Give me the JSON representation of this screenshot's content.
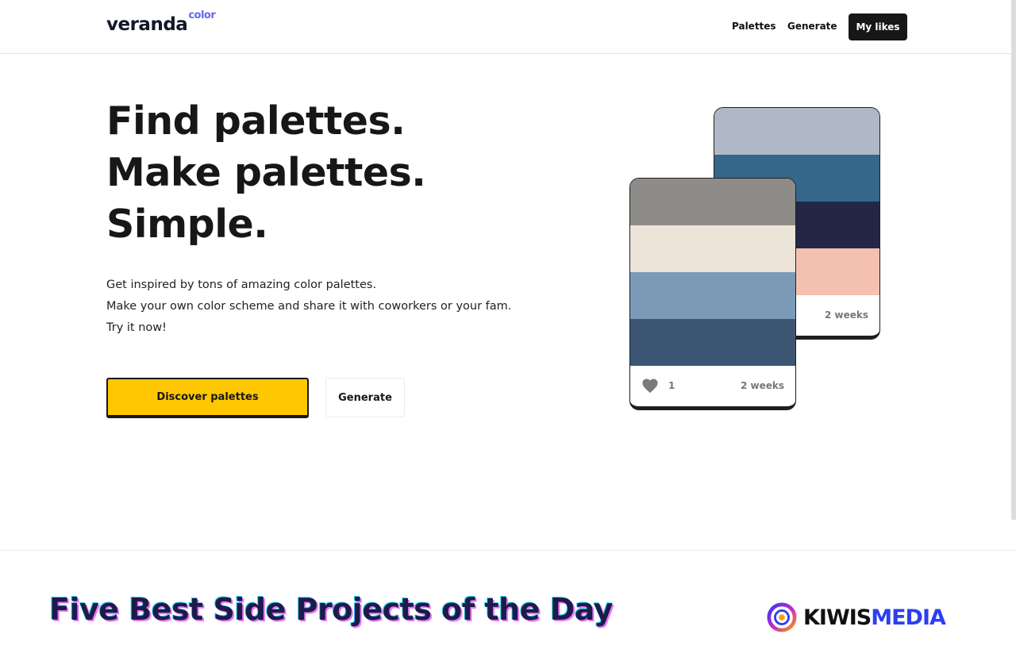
{
  "nav": {
    "logo_main": "veranda",
    "logo_sup": "color",
    "links": [
      "Palettes",
      "Generate"
    ],
    "cta": "My likes"
  },
  "hero": {
    "title_lines": [
      "Find palettes.",
      "Make palettes.",
      "Simple."
    ],
    "desc_lines": [
      "Get inspired by tons of amazing color palettes.",
      "Make your own color scheme and share it with coworkers or your fam.",
      "Try it now!"
    ],
    "discover_label": "Discover palettes",
    "generate_label": "Generate"
  },
  "cards": {
    "back": {
      "colors": [
        "#b0b8c6",
        "#35678a",
        "#232645",
        "#f4c1b1"
      ],
      "time": "2 weeks"
    },
    "front": {
      "colors": [
        "#8e8c89",
        "#ece3d9",
        "#7b9ab8",
        "#3c5573"
      ],
      "likes": "1",
      "time": "2 weeks"
    }
  },
  "banner": {
    "title": "Five Best Side Projects of the Day",
    "brand_a": "KIWIS",
    "brand_b": "MEDIA"
  },
  "colors": {
    "accent_yellow": "#ffc700",
    "logo_accent": "#6366f1",
    "brand_blue": "#2d3ef0"
  }
}
